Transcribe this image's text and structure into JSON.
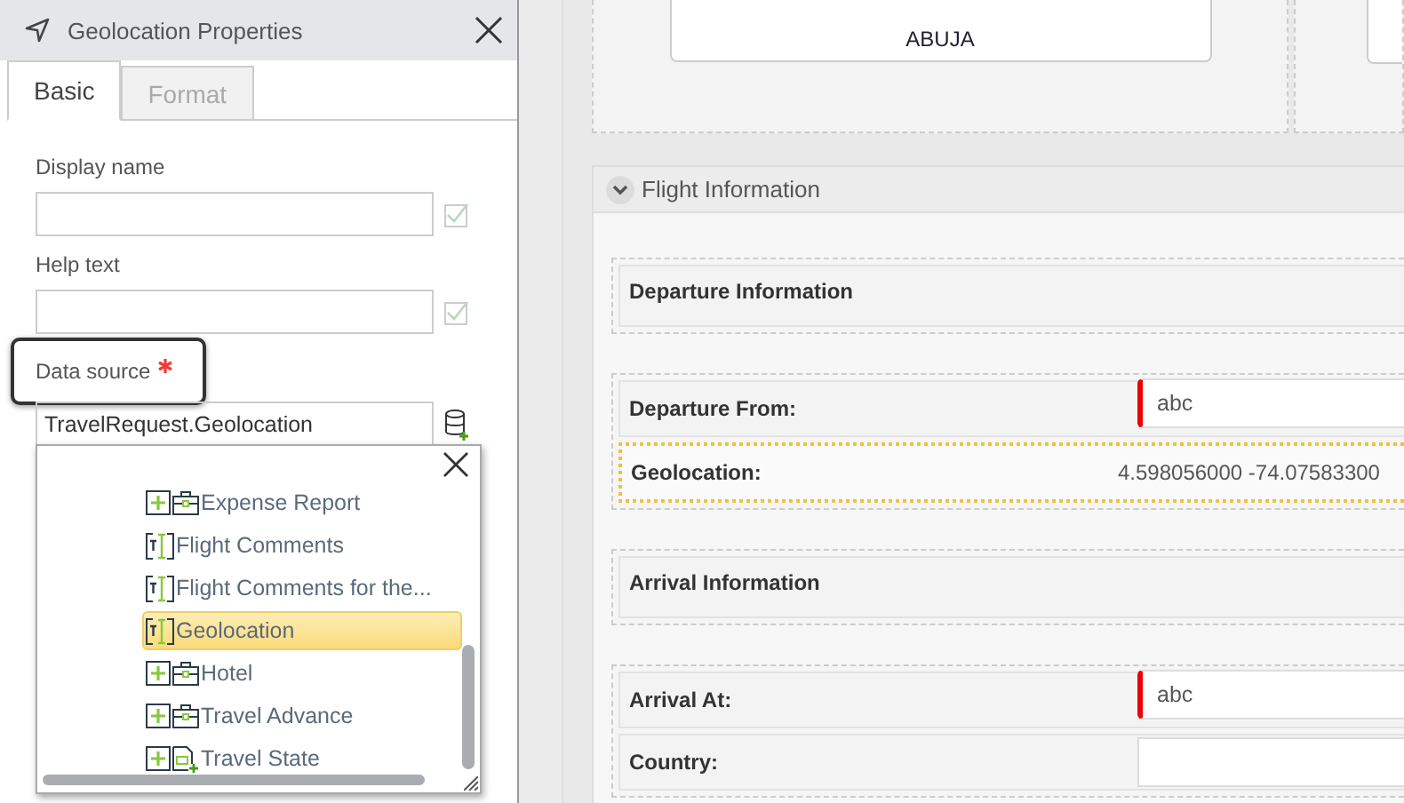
{
  "panel": {
    "title": "Geolocation Properties",
    "tabs": [
      {
        "label": "Basic",
        "selected": true
      },
      {
        "label": "Format",
        "selected": false
      }
    ],
    "fields": [
      {
        "label": "Display name",
        "required": false,
        "highlighted": false,
        "kind": "text"
      },
      {
        "label": "Help text",
        "required": false,
        "highlighted": false,
        "kind": "text"
      },
      {
        "label": "Data source",
        "required": true,
        "highlighted": true,
        "kind": "source",
        "value": "TravelRequest.Geolocation"
      }
    ],
    "picker": {
      "items": [
        {
          "label": "Expense Report",
          "kind": "group",
          "selected": false
        },
        {
          "label": "Flight Comments",
          "kind": "text",
          "selected": false
        },
        {
          "label": "Flight Comments for the...",
          "kind": "text",
          "selected": false
        },
        {
          "label": "Geolocation",
          "kind": "text",
          "selected": true
        },
        {
          "label": "Hotel",
          "kind": "group",
          "selected": false
        },
        {
          "label": "Travel Advance",
          "kind": "group",
          "selected": false
        },
        {
          "label": "Travel State",
          "kind": "form",
          "selected": false
        }
      ]
    }
  },
  "canvas": {
    "card_text": "ABUJA",
    "section": {
      "title": "Flight Information",
      "expanded": true,
      "groups": [
        [
          {
            "kind": "heading",
            "label": "Departure Information"
          }
        ],
        [
          {
            "kind": "input",
            "label": "Departure From:",
            "value": "abc",
            "required": true,
            "selected": false
          },
          {
            "kind": "readonly",
            "label": "Geolocation:",
            "value": "4.598056000 -74.07583300",
            "selected": true
          }
        ],
        [
          {
            "kind": "heading",
            "label": "Arrival Information"
          }
        ],
        [
          {
            "kind": "input",
            "label": "Arrival At:",
            "value": "abc",
            "required": true,
            "selected": false
          },
          {
            "kind": "input",
            "label": "Country:",
            "required": false,
            "selected": false
          }
        ]
      ]
    }
  }
}
